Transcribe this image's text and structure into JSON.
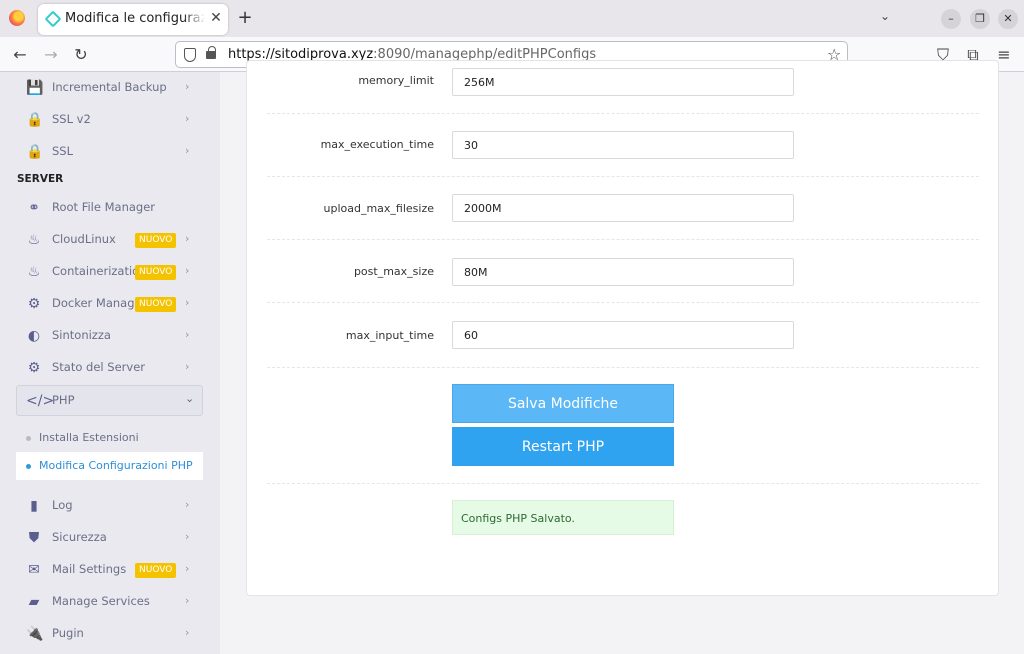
{
  "browser": {
    "tab_title": "Modifica le configurazioni PHP",
    "tab_close": "✕",
    "new_tab": "+",
    "url_host": "https://sitodiprova.xyz",
    "url_path": ":8090/managephp/editPHPConfigs"
  },
  "sidebar": {
    "items_top": [
      {
        "label": "Incremental Backup",
        "icon": "floppy-icon"
      },
      {
        "label": "SSL v2",
        "icon": "lock-icon"
      },
      {
        "label": "SSL",
        "icon": "lock-icon"
      }
    ],
    "section_server": "SERVER",
    "items_server": [
      {
        "label": "Root File Manager",
        "icon": "link-icon"
      },
      {
        "label": "CloudLinux",
        "icon": "fire-icon",
        "badge": "NUOVO"
      },
      {
        "label": "Containerization",
        "icon": "fire-icon",
        "badge": "NUOVO"
      },
      {
        "label": "Docker Manager",
        "icon": "cogs-icon",
        "badge": "NUOVO"
      },
      {
        "label": "Sintonizza",
        "icon": "half-circle-icon"
      },
      {
        "label": "Stato del Server",
        "icon": "gear-icon"
      }
    ],
    "php": {
      "label": "PHP",
      "icon": "code-icon"
    },
    "php_sub": [
      {
        "label": "Installa Estensioni"
      },
      {
        "label": "Modifica Configurazioni PHP"
      }
    ],
    "items_bottom": [
      {
        "label": "Log",
        "icon": "file-icon"
      },
      {
        "label": "Sicurezza",
        "icon": "shield-icon"
      },
      {
        "label": "Mail Settings",
        "icon": "envelope-icon",
        "badge": "NUOVO"
      },
      {
        "label": "Manage Services",
        "icon": "folder-icon"
      },
      {
        "label": "Pugin",
        "icon": "plug-icon"
      }
    ]
  },
  "form": {
    "rows": [
      {
        "label": "memory_limit",
        "value": "256M"
      },
      {
        "label": "max_execution_time",
        "value": "30"
      },
      {
        "label": "upload_max_filesize",
        "value": "2000M"
      },
      {
        "label": "post_max_size",
        "value": "80M"
      },
      {
        "label": "max_input_time",
        "value": "60"
      }
    ],
    "save_label": "Salva Modifiche",
    "restart_label": "Restart PHP",
    "status_message": "Configs PHP Salvato."
  },
  "colors": {
    "primary": "#2fa2f0",
    "badge": "#f5c200",
    "success_bg": "#e5fbe5"
  }
}
